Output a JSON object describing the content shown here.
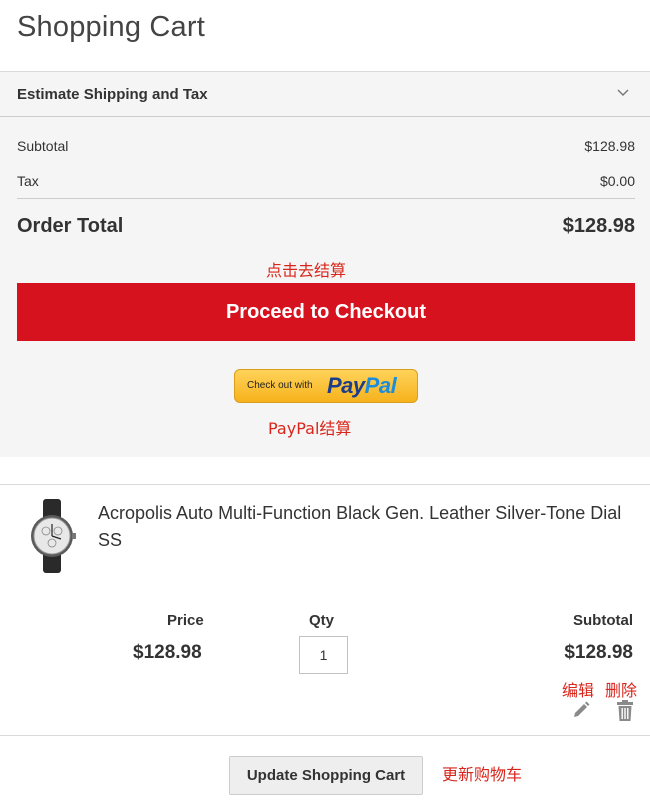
{
  "page": {
    "title": "Shopping Cart"
  },
  "summary": {
    "estimate_label": "Estimate Shipping and Tax",
    "subtotal_label": "Subtotal",
    "subtotal_value": "$128.98",
    "tax_label": "Tax",
    "tax_value": "$0.00",
    "order_total_label": "Order Total",
    "order_total_value": "$128.98",
    "checkout_note": "点击去结算",
    "checkout_label": "Proceed to Checkout",
    "paypal_prefix": "Check out with",
    "paypal_brand_1": "Pay",
    "paypal_brand_2": "Pal",
    "paypal_note": "PayPal结算"
  },
  "item": {
    "name": "Acropolis Auto Multi-Function Black Gen. Leather Silver-Tone Dial SS",
    "price_label": "Price",
    "price_value": "$128.98",
    "qty_label": "Qty",
    "qty_value": "1",
    "subtotal_label": "Subtotal",
    "subtotal_value": "$128.98",
    "edit_note": "编辑",
    "delete_note": "删除"
  },
  "actions": {
    "update_label": "Update Shopping Cart",
    "update_note": "更新购物车"
  },
  "colors": {
    "checkout_bg": "#d7121f",
    "note_red": "#d9261c",
    "paypal_yellow": "#f6b21c",
    "summary_bg": "#f5f5f5"
  },
  "icons": {
    "estimate_toggle": "chevron-down-icon",
    "edit": "pencil-icon",
    "delete": "trash-icon",
    "product": "watch-thumbnail"
  }
}
